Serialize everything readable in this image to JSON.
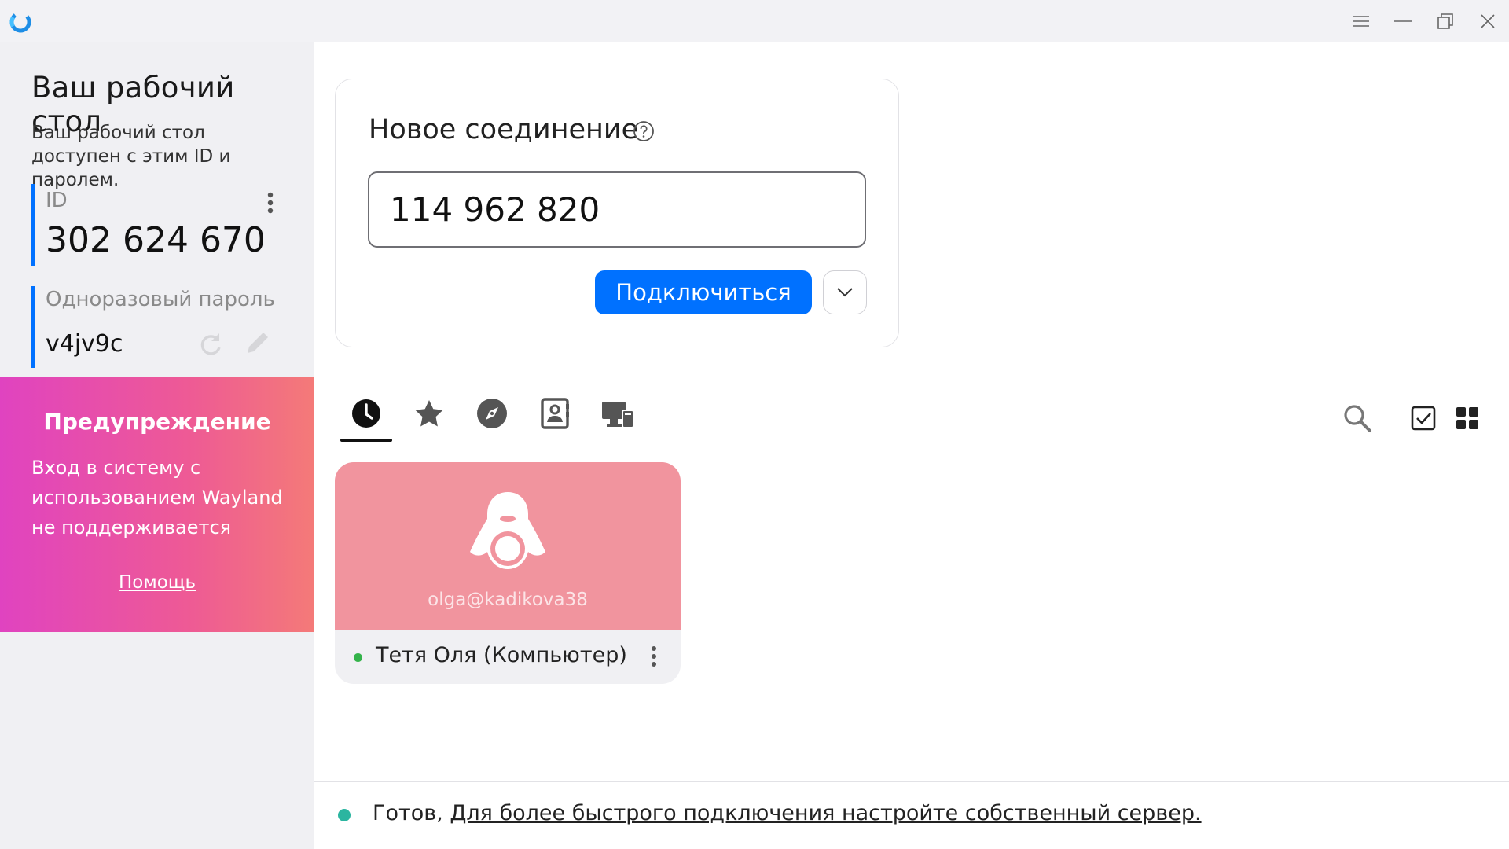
{
  "window": {
    "menu_icon": "hamburger-icon",
    "minimize_icon": "minimize-icon",
    "maximize_icon": "restore-icon",
    "close_icon": "close-icon"
  },
  "sidebar": {
    "title": "Ваш рабочий стол",
    "description": "Ваш рабочий стол доступен с этим ID и паролем.",
    "id_label": "ID",
    "id_value": "302 624 670",
    "password_label": "Одноразовый пароль",
    "password_value": "v4jv9c"
  },
  "warning": {
    "title": "Предупреждение",
    "text": "Вход в систему с использованием Wayland не поддерживается",
    "help_link": "Помощь"
  },
  "connection": {
    "title": "Новое соединение",
    "input_value": "114 962 820",
    "connect_label": "Подключиться"
  },
  "tabs": [
    {
      "name": "recent-sessions",
      "icon": "clock-icon",
      "active": true
    },
    {
      "name": "favorites",
      "icon": "star-icon",
      "active": false
    },
    {
      "name": "discovered",
      "icon": "compass-icon",
      "active": false
    },
    {
      "name": "address-book",
      "icon": "contacts-icon",
      "active": false
    },
    {
      "name": "group",
      "icon": "devices-icon",
      "active": false
    }
  ],
  "peers": [
    {
      "username": "olga@kadikova38",
      "name": "Тетя Оля (Компьютер)",
      "online": true
    }
  ],
  "status": {
    "text": "Готов,",
    "link": "Для более быстрого подключения настройте собственный сервер."
  },
  "colors": {
    "accent": "#0071ff",
    "online": "#34b34a",
    "ready": "#2bb5a0",
    "peer_tile": "#f1949e"
  }
}
